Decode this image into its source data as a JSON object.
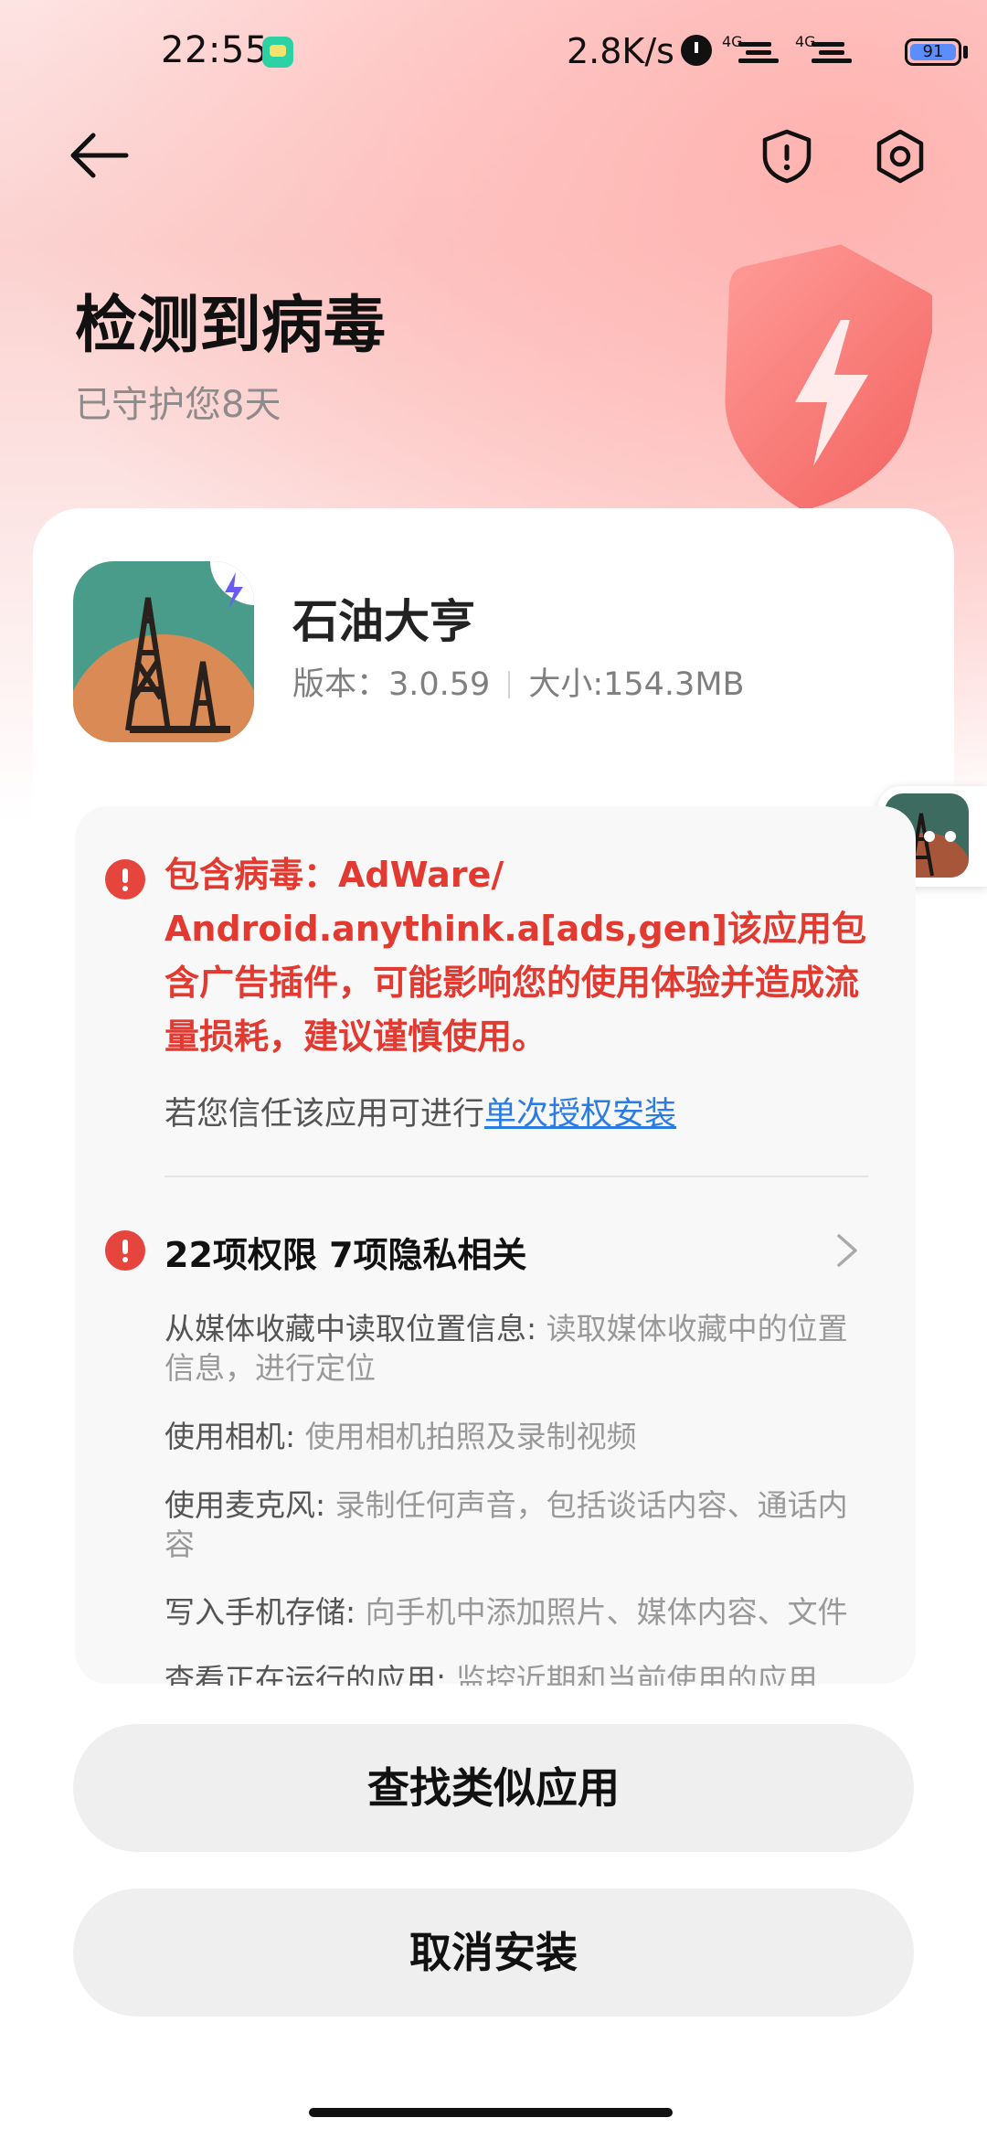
{
  "status_bar": {
    "time": "22:55",
    "speed": "2.8K/s",
    "signal1": "4G",
    "signal2": "4G",
    "battery": "91"
  },
  "header": {
    "title": "检测到病毒",
    "subtitle": "已守护您8天"
  },
  "app": {
    "name": "石油大亨",
    "version": "版本：3.0.59",
    "size": "大小:154.3MB"
  },
  "warning": {
    "text": "包含病毒：AdWare/ Android.anythink.a[ads,gen]该应用包含广告插件，可能影响您的使用体验并造成流量损耗，建议谨慎使用。",
    "trust_prefix": "若您信任该应用可进行",
    "trust_link": "单次授权安装"
  },
  "permissions": {
    "title": "22项权限 7项隐私相关",
    "items": [
      {
        "name": "从媒体收藏中读取位置信息:",
        "desc": " 读取媒体收藏中的位置信息，进行定位"
      },
      {
        "name": "使用相机:",
        "desc": " 使用相机拍照及录制视频"
      },
      {
        "name": "使用麦克风:",
        "desc": " 录制任何声音，包括谈话内容、通话内容"
      },
      {
        "name": "写入手机存储:",
        "desc": " 向手机中添加照片、媒体内容、文件"
      },
      {
        "name": "查看正在运行的应用:",
        "desc": " 监控近期和当前使用的应用"
      }
    ]
  },
  "buttons": {
    "find_similar": "查找类似应用",
    "cancel_install": "取消安装"
  },
  "colors": {
    "danger": "#e23a31",
    "link": "#2a7be4",
    "button_bg": "#efefef"
  }
}
